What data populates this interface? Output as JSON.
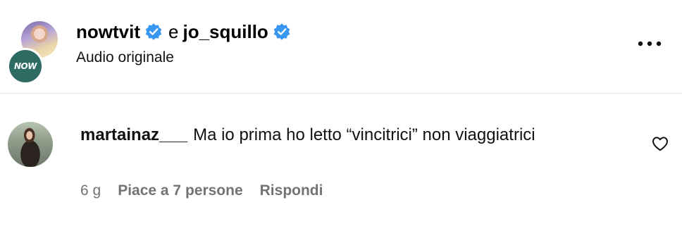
{
  "header": {
    "author_1": "nowtvit",
    "conjunction": "e",
    "author_2": "jo_squillo",
    "subtitle": "Audio originale",
    "avatar_front_text": "NOW",
    "verified_color": "#3897f0",
    "more_icon": "more-horizontal-icon"
  },
  "comment": {
    "username": "martainaz___",
    "text": "Ma io prima ho letto “vincitrici” non viaggiatrici",
    "time": "6 g",
    "likes": "Piace a 7 persone",
    "reply": "Rispondi",
    "like_icon": "heart-outline-icon"
  },
  "colors": {
    "meta_gray": "#737373",
    "divider": "#e6e6e6",
    "now_badge": "#2e6b62"
  }
}
